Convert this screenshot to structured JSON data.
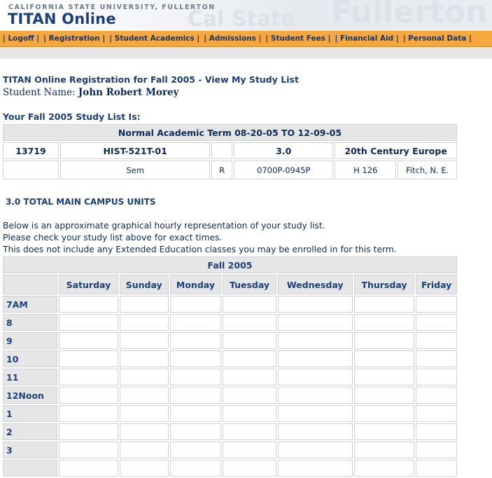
{
  "header": {
    "university": "CALIFORNIA STATE UNIVERSITY, FULLERTON",
    "brand": "TITAN Online",
    "watermark_left": "Cal State",
    "watermark_right": "Fullerton"
  },
  "nav": {
    "items": [
      {
        "label": "| Logoff |"
      },
      {
        "label": "| Registration |"
      },
      {
        "label": "| Student Academics |"
      },
      {
        "label": "| Admissions |"
      },
      {
        "label": "| Student Fees |"
      },
      {
        "label": "| Financial Aid |"
      },
      {
        "label": "| Personal Data |"
      }
    ]
  },
  "page": {
    "title": "TITAN Online Registration for Fall 2005 - View My Study List",
    "student_label": "Student Name:",
    "student_name": "John Robert Morey",
    "list_heading": "Your Fall 2005 Study List Is:"
  },
  "study_list": {
    "term": "Normal Academic Term 08-20-05 TO 12-09-05",
    "course": {
      "number": "13719",
      "code": "HIST-521T-01",
      "units": "3.0",
      "title": "20th Century Europe",
      "type": "Sem",
      "days": "R",
      "time": "0700P-0945P",
      "room": "H 126",
      "instructor": "Fitch, N. E."
    }
  },
  "units_total": "3.0 TOTAL MAIN CAMPUS UNITS",
  "description": {
    "line1": "Below is an approximate graphical hourly representation of your study list.",
    "line2": "Please check your study list above for exact times.",
    "line3": "This does not include any Extended Education classes you may be enrolled in for this term."
  },
  "schedule": {
    "caption": "Fall 2005",
    "days": [
      "Saturday",
      "Sunday",
      "Monday",
      "Tuesday",
      "Wednesday",
      "Thursday",
      "Friday"
    ],
    "hours": [
      "7AM",
      "8",
      "9",
      "10",
      "11",
      "12Noon",
      "1",
      "2",
      "3",
      ""
    ]
  },
  "colors": {
    "nav_bg": "#f7a73f",
    "header_text": "#1b3f77",
    "cell_shade": "#e6e6e6"
  }
}
